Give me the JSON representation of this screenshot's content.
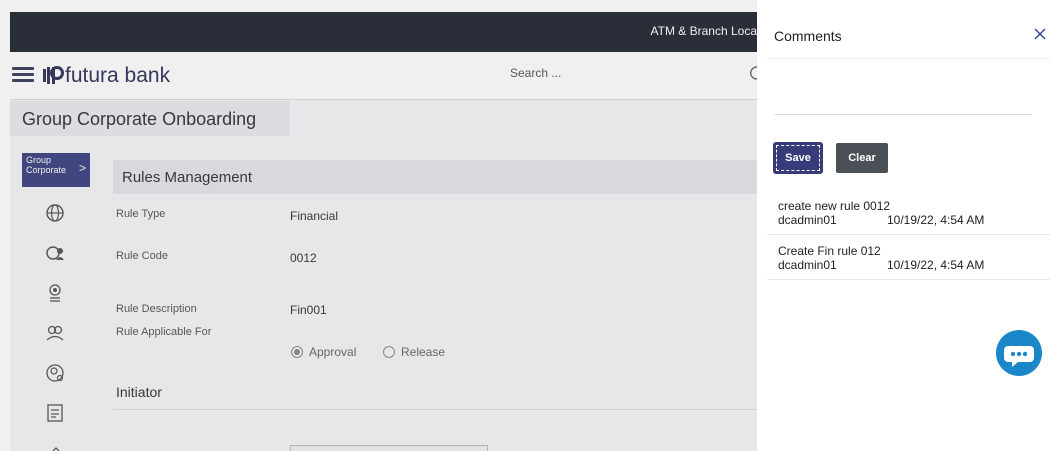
{
  "topbar": {
    "atm_link": "ATM & Branch Loca"
  },
  "header": {
    "brand": "futura bank",
    "search_placeholder": "Search ..."
  },
  "page": {
    "title": "Group Corporate Onboarding"
  },
  "sidebar": {
    "tile_label_1": "Group",
    "tile_label_2": "Corporate",
    "icons": [
      "globe-icon",
      "group-globe-icon",
      "user-badge-icon",
      "users-icon",
      "user-settings-icon",
      "document-icon",
      "partial-icon"
    ]
  },
  "section": {
    "title": "Rules Management",
    "fields": [
      {
        "label": "Rule Type",
        "value": "Financial"
      },
      {
        "label": "Rule Code",
        "value": "0012"
      },
      {
        "label": "Rule Description",
        "value": "Fin001"
      },
      {
        "label": "Rule Applicable For",
        "value": ""
      }
    ],
    "radio_options": [
      "Approval",
      "Release"
    ],
    "radio_selected": "Approval",
    "subsection": "Initiator"
  },
  "comments_panel": {
    "title": "Comments",
    "textarea_value": "",
    "save_label": "Save",
    "clear_label": "Clear",
    "items": [
      {
        "text": "create new rule 0012",
        "user": "dcadmin01",
        "time": "10/19/22, 4:54 AM"
      },
      {
        "text": "Create Fin rule 012",
        "user": "dcadmin01",
        "time": "10/19/22, 4:54 AM"
      }
    ]
  },
  "colors": {
    "brand": "#3d4282",
    "topbar": "#232733",
    "chat": "#1a87c9",
    "clear": "#4b5056"
  }
}
